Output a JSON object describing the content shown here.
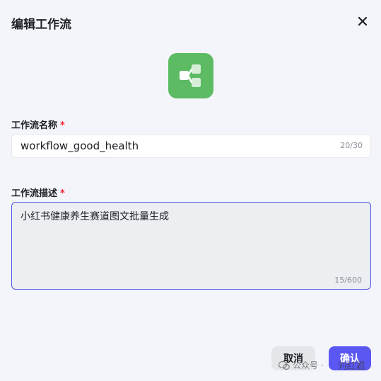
{
  "dialog": {
    "title": "编辑工作流"
  },
  "icons": {
    "close": "close-icon",
    "workflow": "workflow-icon",
    "wechat": "wechat-icon"
  },
  "form": {
    "name_label": "工作流名称",
    "name_required": "*",
    "name_value": "workflow_good_health",
    "name_counter": "20/30",
    "desc_label": "工作流描述",
    "desc_required": "*",
    "desc_value": "小红书健康养生赛道图文批量生成",
    "desc_counter": "15/600"
  },
  "actions": {
    "cancel_label": "取消",
    "confirm_label": "确认"
  },
  "watermark": {
    "source": "公众号 ·",
    "author": "刘红君"
  },
  "colors": {
    "background": "#f4f5fa",
    "icon_tile": "#5dbb63",
    "accent": "#5b57f2",
    "focus_border": "#4d53e8",
    "required": "#f5222d"
  }
}
